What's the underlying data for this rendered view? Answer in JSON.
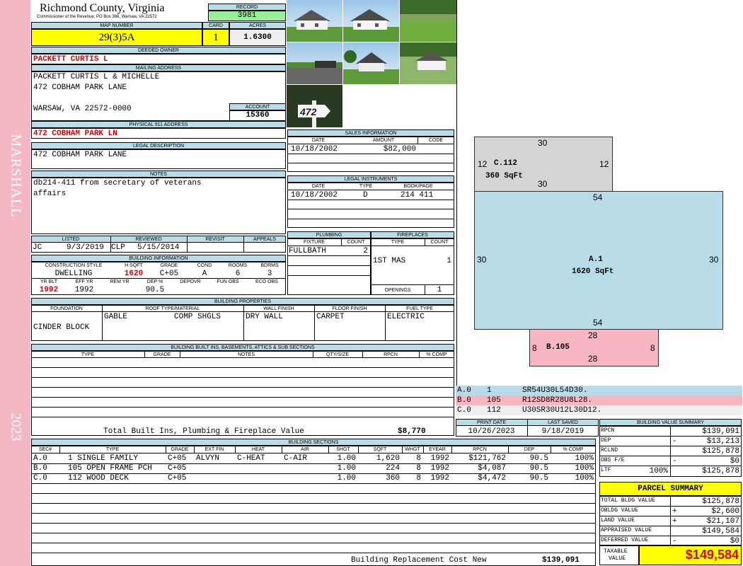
{
  "side": {
    "district": "MARSHALL",
    "year": "2023"
  },
  "county": {
    "title": "Richmond County, Virginia",
    "subtitle": "Commissioner of the Revenue, PO Box 366, Warsaw, VA 22572"
  },
  "record": {
    "label": "RECORD",
    "value": "3981"
  },
  "map": {
    "label": "MAP NUMBER",
    "value": "29(3)5A"
  },
  "card": {
    "label": "CARD",
    "value": "1"
  },
  "acres": {
    "label": "ACRES",
    "value": "1.6300"
  },
  "owner": {
    "label": "DEEDED OWNER",
    "value": "PACKETT CURTIS L"
  },
  "mailing": {
    "label": "MAILING ADDRESS",
    "line1": "PACKETT CURTIS L & MICHELLE",
    "line2": "472 COBHAM PARK LANE",
    "line3": "WARSAW, VA 22572-0000"
  },
  "account": {
    "label": "ACCOUNT",
    "value": "15360"
  },
  "physical": {
    "label": "PHYSICAL 911 ADDRESS",
    "value": "472 COBHAM PARK LN"
  },
  "legal": {
    "label": "LEGAL DESCRIPTION",
    "value": "472 COBHAM PARK LANE"
  },
  "notes": {
    "label": "NOTES",
    "line1": "db214-411 from secretary of veterans",
    "line2": "affairs"
  },
  "sales": {
    "label": "SALES INFORMATION",
    "h_date": "DATE",
    "h_amount": "AMOUNT",
    "h_code": "CODE",
    "date": "10/18/2002",
    "amount": "$82,000"
  },
  "instruments": {
    "label": "LEGAL INSTRUMENTS",
    "h_date": "DATE",
    "h_type": "TYPE",
    "h_book": "BOOK/PAGE",
    "date": "10/18/2002",
    "type": "D",
    "book": "214 411"
  },
  "listed": {
    "h_listed": "LISTED",
    "h_reviewed": "REVIEWED",
    "h_revisit": "REVISIT",
    "h_appeals": "APPEALS",
    "listed_by": "JC",
    "listed_date": "9/3/2019",
    "reviewed_by": "CLP",
    "reviewed_date": "5/15/2014"
  },
  "plumbing": {
    "label": "PLUMBING",
    "h_fixture": "FIXTURE",
    "h_count": "COUNT",
    "fixture": "FULLBATH",
    "count": "2"
  },
  "fireplaces": {
    "label": "FIREPLACES",
    "h_type": "TYPE",
    "h_count": "COUNT",
    "type": "1ST MAS",
    "count": "1",
    "openings_label": "OPENINGS",
    "openings": "1"
  },
  "building": {
    "label": "BUILDING INFORMATION",
    "h_style": "CONSTRUCTION STYLE",
    "h_sqft": "H SQFT",
    "h_grade": "GRADE",
    "h_cond": "COND",
    "h_rooms": "ROOMS",
    "h_bdrms": "BDRMS",
    "style": "DWELLING",
    "sqft": "1620",
    "grade": "C+05",
    "cond": "A",
    "rooms": "6",
    "bdrms": "3",
    "h_yrblt": "YR BLT",
    "h_effyr": "EFF YR",
    "h_remyr": "REM YR",
    "h_dep": "DEP %",
    "h_depovr": "DEPOVR",
    "h_funobs": "FUN OBS",
    "h_ecoobs": "ECO OBS",
    "yrblt": "1992",
    "effyr": "1992",
    "dep": "90.5"
  },
  "properties": {
    "label": "BUILDING PROPERTIES",
    "h_foundation": "FOUNDATION",
    "h_roof": "ROOF TYPE/MATERIAL",
    "h_wall": "WALL FINISH",
    "h_floor": "FLOOR FINISH",
    "h_fuel": "FUEL TYPE",
    "foundation": "CINDER BLOCK",
    "roof_type": "GABLE",
    "roof_mat": "COMP SHGLS",
    "wall": "DRY WALL",
    "floor": "CARPET",
    "fuel": "ELECTRIC"
  },
  "builtins": {
    "label": "BUILDING BUILT INS, BASEMENTS, ATTICS & SUB SECTIONS",
    "h_type": "TYPE",
    "h_grade": "GRADE",
    "h_notes": "NOTES",
    "h_qty": "QTY/SIZE",
    "h_rpcn": "RPCN",
    "h_comp": "% COMP",
    "total_label": "Total Built Ins, Plumbing & Fireplace Value",
    "total": "$8,770"
  },
  "print": {
    "h_print": "PRINT DATE",
    "h_saved": "LAST SAVED",
    "print_date": "10/26/2023",
    "last_saved": "9/18/2019"
  },
  "sections": {
    "label": "BUILDING SECTIONS",
    "headers": {
      "sec": "SEC#",
      "type": "TYPE",
      "grade": "GRADE",
      "extfin": "EXT FIN",
      "heat": "HEAT",
      "air": "AIR",
      "shgt": "SHGT",
      "sqft": "SQFT",
      "whgt": "WHGT",
      "eyear": "EYEAR",
      "rpcn": "RPCN",
      "dep": "DEP",
      "comp": "% COMP"
    },
    "rows": [
      {
        "sec": "A.0",
        "type": "1 SINGLE FAMILY",
        "grade": "C+05",
        "extfin": "ALVYN",
        "heat": "C-HEAT",
        "air": "C-AIR",
        "shgt": "1.00",
        "sqft": "1,620",
        "whgt": "8",
        "eyear": "1992",
        "rpcn": "$121,762",
        "dep": "90.5",
        "comp": "100%"
      },
      {
        "sec": "B.0",
        "type": "105 OPEN FRAME PCH",
        "grade": "C+05",
        "extfin": "",
        "heat": "",
        "air": "",
        "shgt": "1.00",
        "sqft": "224",
        "whgt": "8",
        "eyear": "1992",
        "rpcn": "$4,087",
        "dep": "90.5",
        "comp": "100%"
      },
      {
        "sec": "C.0",
        "type": "112 WOOD DECK",
        "grade": "C+05",
        "extfin": "",
        "heat": "",
        "air": "",
        "shgt": "1.00",
        "sqft": "360",
        "whgt": "8",
        "eyear": "1992",
        "rpcn": "$4,472",
        "dep": "90.5",
        "comp": "100%"
      }
    ],
    "total_label": "Building Replacement Cost New",
    "total": "$139,091"
  },
  "sketch": {
    "c": {
      "name": "C.112",
      "area": "360 SqFt",
      "top": "30",
      "bottom": "30",
      "left": "12",
      "right": "12"
    },
    "a": {
      "name": "A.1",
      "area": "1620 SqFt",
      "top": "54",
      "bottom": "54",
      "left": "30",
      "right": "30"
    },
    "b": {
      "name": "B.105",
      "top": "28",
      "bottom": "28",
      "left": "8",
      "right": "8"
    },
    "legend": [
      {
        "code": "A.0",
        "num": "1",
        "vec": "SR54U30L54D30.",
        "color": "#b9dde8"
      },
      {
        "code": "B.0",
        "num": "105",
        "vec": "R12SD8R28U8L28.",
        "color": "#f7b6c2"
      },
      {
        "code": "C.0",
        "num": "112",
        "vec": "U30SR30U12L30D12.",
        "color": "#d4d4d4"
      }
    ]
  },
  "photo_sign": "472",
  "bvs": {
    "label": "BUILDING VALUE SUMMARY",
    "rows": [
      {
        "k": "RPCN",
        "sign": "",
        "pct": "",
        "v": "$139,091"
      },
      {
        "k": "DEP",
        "sign": "-",
        "pct": "",
        "v": "$13,213"
      },
      {
        "k": "RCLND",
        "sign": "",
        "pct": "",
        "v": "$125,878"
      },
      {
        "k": "OBS F/E",
        "sign": "-",
        "pct": "",
        "v": "$0"
      },
      {
        "k": "LTF",
        "sign": "",
        "pct": "100%",
        "v": "$125,878"
      }
    ]
  },
  "parcel": {
    "label": "PARCEL SUMMARY",
    "rows": [
      {
        "k": "TOTAL BLDG VALUE",
        "sign": "",
        "v": "$125,878"
      },
      {
        "k": "OBLDG VALUE",
        "sign": "+",
        "v": "$2,600"
      },
      {
        "k": "LAND VALUE",
        "sign": "+",
        "v": "$21,107"
      },
      {
        "k": "APPRAISED VALUE",
        "sign": "",
        "v": "$149,584"
      },
      {
        "k": "DEFERRED VALUE",
        "sign": "-",
        "v": "$0"
      }
    ],
    "taxable_label1": "TAXABLE",
    "taxable_label2": "VALUE",
    "taxable": "$149,584"
  },
  "colors": {
    "header": "#b9dde8",
    "yellow": "#ffff00",
    "green": "#99ee99",
    "pink": "#f7b6c2",
    "sidebar": "#f4b8c4",
    "red": "#dd0000"
  }
}
